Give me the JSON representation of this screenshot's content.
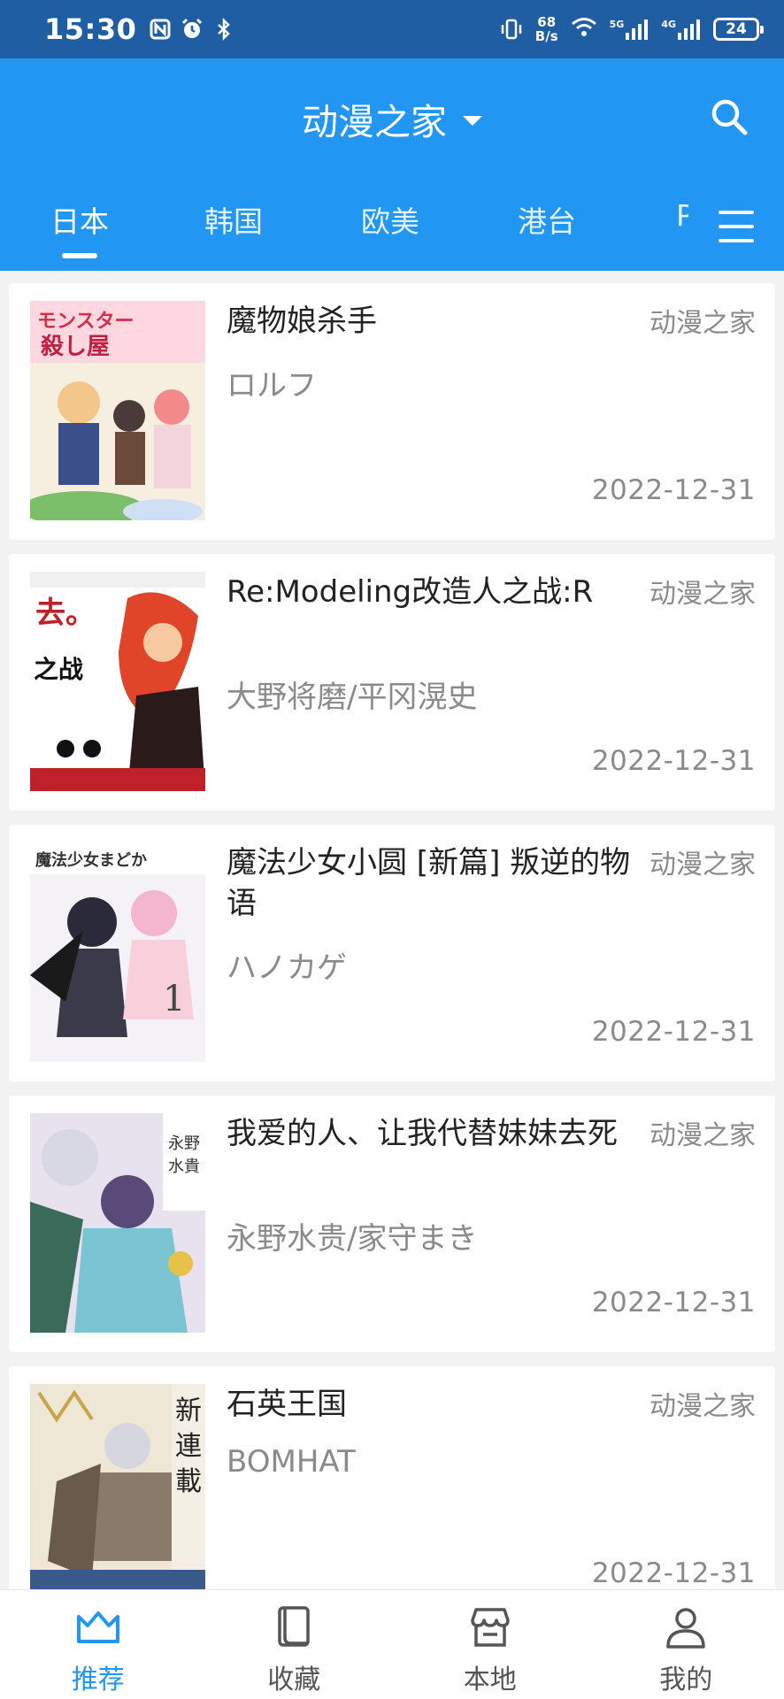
{
  "status_bar": {
    "time": "15:30",
    "net_speed_value": "68",
    "net_speed_unit": "B/s",
    "sim1": "5G",
    "sim2": "4G",
    "battery": "24"
  },
  "header": {
    "title": "动漫之家",
    "search_icon": "search-icon",
    "menu_icon": "menu-icon"
  },
  "tabs": [
    {
      "label": "日本",
      "active": true
    },
    {
      "label": "韩国",
      "active": false
    },
    {
      "label": "欧美",
      "active": false
    },
    {
      "label": "港台",
      "active": false
    },
    {
      "label": "P",
      "active": false
    }
  ],
  "comics": [
    {
      "title": "魔物娘杀手",
      "author": "ロルフ",
      "source": "动漫之家",
      "date": "2022-12-31"
    },
    {
      "title": "Re:Modeling改造人之战:R",
      "author": "大野将磨/平冈滉史",
      "source": "动漫之家",
      "date": "2022-12-31"
    },
    {
      "title": "魔法少女小圆 [新篇] 叛逆的物语",
      "author": "ハノカゲ",
      "source": "动漫之家",
      "date": "2022-12-31"
    },
    {
      "title": "我爱的人、让我代替妹妹去死",
      "author": "永野水贵/家守まき",
      "source": "动漫之家",
      "date": "2022-12-31"
    },
    {
      "title": "石英王国",
      "author": "BOMHAT",
      "source": "动漫之家",
      "date": "2022-12-31"
    }
  ],
  "bottom_nav": [
    {
      "label": "推荐",
      "icon": "crown-icon",
      "active": true
    },
    {
      "label": "收藏",
      "icon": "book-icon",
      "active": false
    },
    {
      "label": "本地",
      "icon": "store-icon",
      "active": false
    },
    {
      "label": "我的",
      "icon": "person-icon",
      "active": false
    }
  ],
  "colors": {
    "status_bar": "#1f5ea3",
    "primary": "#2196f3",
    "text_secondary": "#8a8a8a"
  }
}
